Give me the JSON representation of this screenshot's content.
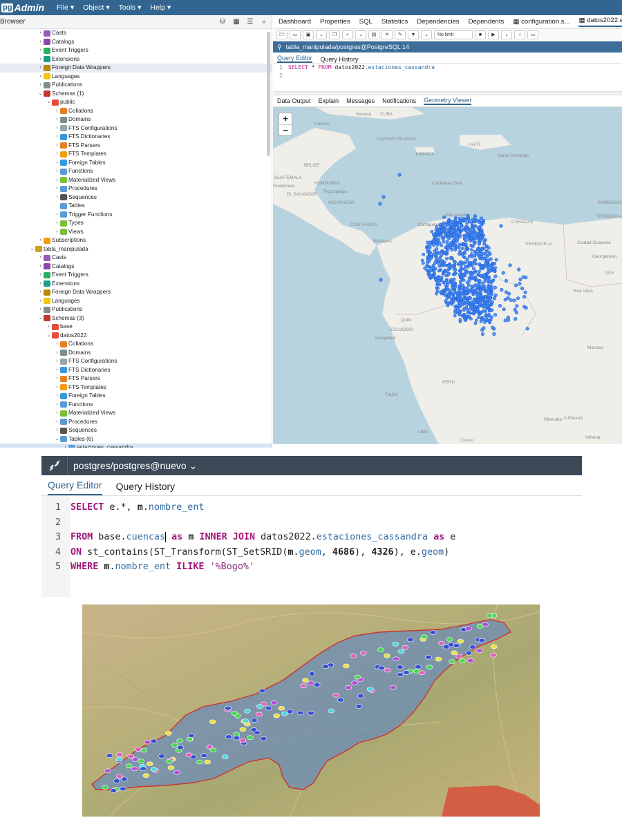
{
  "app": {
    "logo_pg": "pg",
    "logo_admin": "Admin",
    "menu": [
      "File ▾",
      "Object ▾",
      "Tools ▾",
      "Help ▾"
    ]
  },
  "browser": {
    "title": "Browser",
    "tree": [
      {
        "label": "Casts",
        "depth": 1,
        "caret": "›",
        "icon": "casts-icon",
        "color": "#9b59b6"
      },
      {
        "label": "Catalogs",
        "depth": 1,
        "caret": "›",
        "icon": "catalogs-icon",
        "color": "#8e44ad"
      },
      {
        "label": "Event Triggers",
        "depth": 1,
        "caret": "›",
        "icon": "event-triggers-icon",
        "color": "#27ae60"
      },
      {
        "label": "Extensions",
        "depth": 1,
        "caret": "›",
        "icon": "extensions-icon",
        "color": "#16a085"
      },
      {
        "label": "Foreign Data Wrappers",
        "depth": 1,
        "caret": "›",
        "icon": "fdw-icon",
        "color": "#b8860b",
        "highlight": true
      },
      {
        "label": "Languages",
        "depth": 1,
        "caret": "›",
        "icon": "languages-icon",
        "color": "#f1c40f"
      },
      {
        "label": "Publications",
        "depth": 1,
        "caret": "›",
        "icon": "publications-icon",
        "color": "#7f8c8d"
      },
      {
        "label": "Schemas (1)",
        "depth": 1,
        "caret": "⌄",
        "icon": "schemas-icon",
        "color": "#c0392b"
      },
      {
        "label": "public",
        "depth": 2,
        "caret": "⌄",
        "icon": "schema-icon",
        "color": "#e74c3c"
      },
      {
        "label": "Collations",
        "depth": 3,
        "caret": "›",
        "icon": "collations-icon",
        "color": "#e67e22"
      },
      {
        "label": "Domains",
        "depth": 3,
        "caret": "›",
        "icon": "domains-icon",
        "color": "#7f8c8d"
      },
      {
        "label": "FTS Configurations",
        "depth": 3,
        "caret": "›",
        "icon": "fts-config-icon",
        "color": "#95a5a6"
      },
      {
        "label": "FTS Dictionaries",
        "depth": 3,
        "caret": "›",
        "icon": "fts-dict-icon",
        "color": "#3498db"
      },
      {
        "label": "FTS Parsers",
        "depth": 3,
        "caret": "›",
        "icon": "fts-parsers-icon",
        "color": "#e67e22"
      },
      {
        "label": "FTS Templates",
        "depth": 3,
        "caret": "›",
        "icon": "fts-templates-icon",
        "color": "#f39c12"
      },
      {
        "label": "Foreign Tables",
        "depth": 3,
        "caret": "›",
        "icon": "foreign-tables-icon",
        "color": "#3498db"
      },
      {
        "label": "Functions",
        "depth": 3,
        "caret": "›",
        "icon": "functions-icon",
        "color": "#5b9bd5"
      },
      {
        "label": "Materialized Views",
        "depth": 3,
        "caret": "›",
        "icon": "mat-views-icon",
        "color": "#7dbd3a"
      },
      {
        "label": "Procedures",
        "depth": 3,
        "caret": "›",
        "icon": "procedures-icon",
        "color": "#5b9bd5"
      },
      {
        "label": "Sequences",
        "depth": 3,
        "caret": "›",
        "icon": "sequences-icon",
        "color": "#555555"
      },
      {
        "label": "Tables",
        "depth": 3,
        "caret": "",
        "icon": "tables-icon",
        "color": "#5b9bd5"
      },
      {
        "label": "Trigger Functions",
        "depth": 3,
        "caret": "›",
        "icon": "trigger-functions-icon",
        "color": "#5b9bd5"
      },
      {
        "label": "Types",
        "depth": 3,
        "caret": "›",
        "icon": "types-icon",
        "color": "#7dbd3a"
      },
      {
        "label": "Views",
        "depth": 3,
        "caret": "›",
        "icon": "views-icon",
        "color": "#7dbd3a"
      },
      {
        "label": "Subscriptions",
        "depth": 1,
        "caret": "›",
        "icon": "subscriptions-icon",
        "color": "#f39c12"
      },
      {
        "label": "tabla_manipulada",
        "depth": 0,
        "caret": "⌄",
        "icon": "database-icon",
        "color": "#c9a227"
      },
      {
        "label": "Casts",
        "depth": 1,
        "caret": "›",
        "icon": "casts-icon",
        "color": "#9b59b6"
      },
      {
        "label": "Catalogs",
        "depth": 1,
        "caret": "›",
        "icon": "catalogs-icon",
        "color": "#8e44ad"
      },
      {
        "label": "Event Triggers",
        "depth": 1,
        "caret": "›",
        "icon": "event-triggers-icon",
        "color": "#27ae60"
      },
      {
        "label": "Extensions",
        "depth": 1,
        "caret": "›",
        "icon": "extensions-icon",
        "color": "#16a085"
      },
      {
        "label": "Foreign Data Wrappers",
        "depth": 1,
        "caret": "›",
        "icon": "fdw-icon",
        "color": "#b8860b"
      },
      {
        "label": "Languages",
        "depth": 1,
        "caret": "›",
        "icon": "languages-icon",
        "color": "#f1c40f"
      },
      {
        "label": "Publications",
        "depth": 1,
        "caret": "›",
        "icon": "publications-icon",
        "color": "#7f8c8d"
      },
      {
        "label": "Schemas (3)",
        "depth": 1,
        "caret": "⌄",
        "icon": "schemas-icon",
        "color": "#c0392b"
      },
      {
        "label": "base",
        "depth": 2,
        "caret": "›",
        "icon": "schema-icon",
        "color": "#e74c3c"
      },
      {
        "label": "datos2022",
        "depth": 2,
        "caret": "⌄",
        "icon": "schema-icon",
        "color": "#e74c3c"
      },
      {
        "label": "Collations",
        "depth": 3,
        "caret": "›",
        "icon": "collations-icon",
        "color": "#e67e22"
      },
      {
        "label": "Domains",
        "depth": 3,
        "caret": "›",
        "icon": "domains-icon",
        "color": "#7f8c8d"
      },
      {
        "label": "FTS Configurations",
        "depth": 3,
        "caret": "›",
        "icon": "fts-config-icon",
        "color": "#95a5a6"
      },
      {
        "label": "FTS Dictionaries",
        "depth": 3,
        "caret": "›",
        "icon": "fts-dict-icon",
        "color": "#3498db"
      },
      {
        "label": "FTS Parsers",
        "depth": 3,
        "caret": "›",
        "icon": "fts-parsers-icon",
        "color": "#e67e22"
      },
      {
        "label": "FTS Templates",
        "depth": 3,
        "caret": "›",
        "icon": "fts-templates-icon",
        "color": "#f39c12"
      },
      {
        "label": "Foreign Tables",
        "depth": 3,
        "caret": "›",
        "icon": "foreign-tables-icon",
        "color": "#3498db"
      },
      {
        "label": "Functions",
        "depth": 3,
        "caret": "›",
        "icon": "functions-icon",
        "color": "#5b9bd5"
      },
      {
        "label": "Materialized Views",
        "depth": 3,
        "caret": "›",
        "icon": "mat-views-icon",
        "color": "#7dbd3a"
      },
      {
        "label": "Procedures",
        "depth": 3,
        "caret": "›",
        "icon": "procedures-icon",
        "color": "#5b9bd5"
      },
      {
        "label": "Sequences",
        "depth": 3,
        "caret": "›",
        "icon": "sequences-icon",
        "color": "#555555"
      },
      {
        "label": "Tables (6)",
        "depth": 3,
        "caret": "⌄",
        "icon": "tables-icon",
        "color": "#5b9bd5"
      },
      {
        "label": "estaciones_cassandra",
        "depth": 4,
        "caret": "›",
        "icon": "table-icon",
        "color": "#5b9bd5",
        "selected": true
      }
    ]
  },
  "main": {
    "tabs": [
      "Dashboard",
      "Properties",
      "SQL",
      "Statistics",
      "Dependencies",
      "Dependents",
      "▦ configuration.s...",
      "▦ datos2022.es"
    ],
    "active_tab": 7,
    "limit_label": "No limit",
    "connection": "tabla_manipulada/postgres@PostgreSQL 14",
    "query_tabs": [
      "Query Editor",
      "Query History"
    ],
    "sql_lines": [
      {
        "n": "1",
        "parts": [
          [
            "kw",
            "SELECT"
          ],
          [
            "t",
            " * "
          ],
          [
            "kw",
            "FROM"
          ],
          [
            "t",
            " datos2022."
          ],
          [
            "ident",
            "estaciones_cassandra"
          ]
        ]
      },
      {
        "n": "2",
        "parts": []
      }
    ],
    "output_tabs": [
      "Data Output",
      "Explain",
      "Messages",
      "Notifications",
      "Geometry Viewer"
    ],
    "active_output": 4,
    "zoom_in": "+",
    "zoom_out": "−",
    "map_labels": [
      "Havana",
      "CUBA",
      "Cancún",
      "CAYMAN ISLANDS",
      "JAMAICA",
      "HAITI",
      "Santo Domingo",
      "BELIZE",
      "GUATEMALA",
      "HONDURAS",
      "Caribbean Sea",
      "Tegucigalpa",
      "NICARAGUA",
      "COSTA RICA",
      "PANAMA",
      "Cartagena",
      "Barranquilla",
      "CARACAS",
      "VENEZUELA",
      "Ciudad Guayana",
      "Georgetown",
      "GUY",
      "Boa Vista",
      "Quito",
      "ECUADOR",
      "Guayaquil",
      "Manaus",
      "PERU",
      "Trujillo",
      "Riberalta",
      "Ji-Paraná",
      "Vilhena",
      "LIMA",
      "Cusco",
      "BARBADOS",
      "TRINIDAD AND TOBAGO",
      "EL SALVADOR",
      "Guatemala"
    ]
  },
  "editor2": {
    "connection": "postgres/postgres@nuevo ⌄",
    "tabs": [
      "Query Editor",
      "Query History"
    ],
    "lines": [
      {
        "n": "1",
        "parts": [
          [
            "k",
            "SELECT"
          ],
          [
            "t",
            " e.*, "
          ],
          [
            "n",
            "m"
          ],
          [
            "t",
            "."
          ],
          [
            "i",
            "nombre_ent"
          ]
        ]
      },
      {
        "n": "2",
        "parts": []
      },
      {
        "n": "3",
        "parts": [
          [
            "k",
            "FROM"
          ],
          [
            "t",
            " base."
          ],
          [
            "i",
            "cuencas"
          ],
          [
            "c",
            ""
          ],
          [
            "t",
            " "
          ],
          [
            "k",
            "as"
          ],
          [
            "t",
            " "
          ],
          [
            "n",
            "m"
          ],
          [
            "t",
            " "
          ],
          [
            "k",
            "INNER JOIN"
          ],
          [
            "t",
            " datos2022."
          ],
          [
            "i",
            "estaciones_cassandra"
          ],
          [
            "t",
            " "
          ],
          [
            "k",
            "as"
          ],
          [
            "t",
            " e"
          ]
        ]
      },
      {
        "n": "4",
        "parts": [
          [
            "k",
            "ON"
          ],
          [
            "t",
            " st_contains(ST_Transform(ST_SetSRID("
          ],
          [
            "n",
            "m"
          ],
          [
            "t",
            "."
          ],
          [
            "i",
            "geom"
          ],
          [
            "t",
            ", "
          ],
          [
            "n",
            "4686"
          ],
          [
            "t",
            "), "
          ],
          [
            "n",
            "4326"
          ],
          [
            "t",
            "), e."
          ],
          [
            "i",
            "geom"
          ],
          [
            "t",
            ")"
          ]
        ]
      },
      {
        "n": "5",
        "parts": [
          [
            "k",
            "WHERE"
          ],
          [
            "t",
            " "
          ],
          [
            "n",
            "m"
          ],
          [
            "t",
            "."
          ],
          [
            "i",
            "nombre_ent"
          ],
          [
            "t",
            " "
          ],
          [
            "k",
            "ILIKE"
          ],
          [
            "t",
            " "
          ],
          [
            "s",
            "'%Bogo%'"
          ]
        ]
      }
    ]
  },
  "colors": {
    "brand": "#326690",
    "point_blue": "#3b82f6",
    "basin_fill": "#7a98b8",
    "basin_border": "#d13b3b"
  }
}
